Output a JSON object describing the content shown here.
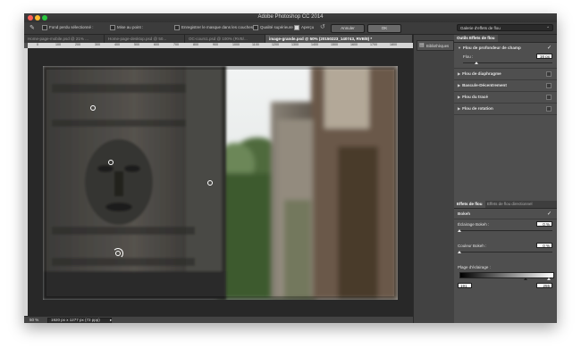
{
  "window": {
    "title": "Adobe Photoshop CC 2014"
  },
  "options_bar": {
    "fond_perdu": "Fond perdu sélectionné :",
    "mise_au_point": "Mise au point :",
    "enregistrer_masque": "Enregistrer le masque dans les couches",
    "qualite_superieure": "Qualité supérieure",
    "apercu": "Aperçu",
    "annuler": "Annuler",
    "ok": "OK",
    "workspace_select": "Galerie d'effets de flou"
  },
  "tabs": [
    "Home-page-mobile.psd @ 21% ...",
    "Home-page-desktop.psd @ 50...",
    "OC-cours1.psd @ 100% (RVB/...",
    "image-grande.psd @ 50% (20150223_140743, RVB/8) *"
  ],
  "ruler": {
    "ticks": [
      "0",
      "100",
      "200",
      "300",
      "400",
      "500",
      "600",
      "700",
      "800",
      "900",
      "1000",
      "1100",
      "1200",
      "1300",
      "1400",
      "1500",
      "1600",
      "1700",
      "1800"
    ]
  },
  "status": {
    "zoom": "50 %",
    "doc_size": "1920 px x 1277 px (72 ppp)"
  },
  "dock": {
    "libraries_label": "Bibliothèques"
  },
  "panel": {
    "tools_title": "Outils Effets de flou",
    "effects": [
      {
        "label": "Flou de profondeur de champ",
        "checked": true
      },
      {
        "label": "Flou de diaphragme",
        "checked": false
      },
      {
        "label": "Bascule-Décentrement",
        "checked": false
      },
      {
        "label": "Flou du tracé",
        "checked": false
      },
      {
        "label": "Flou de rotation",
        "checked": false
      }
    ],
    "flou_label": "Flou :",
    "flou_value": "16 px",
    "bottom_tabs": [
      "Effets de flou",
      "Effets de flou directionnel"
    ],
    "bokeh_title": "Bokeh",
    "eclairage_label": "Éclairage Bokeh :",
    "eclairage_value": "0 %",
    "couleur_label": "Couleur Bokeh :",
    "couleur_value": "0 %",
    "plage_label": "Plage d'éclairage :",
    "plage_min": "191",
    "plage_max": "255"
  }
}
